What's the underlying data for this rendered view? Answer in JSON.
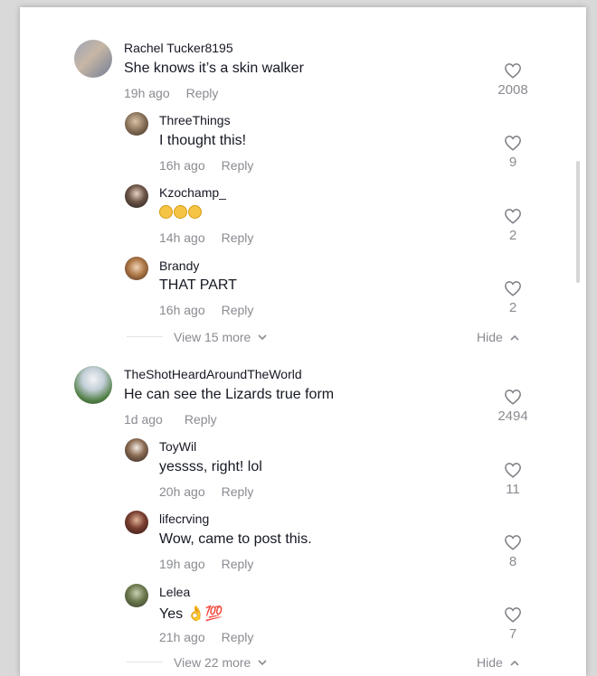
{
  "threads": [
    {
      "comment": {
        "user": "Rachel Tucker8195",
        "text": "She knows it’s a skin walker",
        "time": "19h ago",
        "reply_label": "Reply",
        "likes": "2008"
      },
      "replies": [
        {
          "user": "ThreeThings",
          "text": "I thought this!",
          "time": "16h ago",
          "reply_label": "Reply",
          "likes": "9"
        },
        {
          "user": "Kzochamp_",
          "text": "",
          "emoji": "laughing-tears x3",
          "time": "14h ago",
          "reply_label": "Reply",
          "likes": "2"
        },
        {
          "user": "Brandy",
          "text": "THAT PART",
          "time": "16h ago",
          "reply_label": "Reply",
          "likes": "2"
        }
      ],
      "view_more": "View 15 more",
      "hide": "Hide"
    },
    {
      "comment": {
        "user": "TheShotHeardAroundTheWorld",
        "text": "He can see the Lizards true form",
        "time": "1d ago",
        "reply_label": "Reply",
        "likes": "2494"
      },
      "replies": [
        {
          "user": "ToyWil",
          "text": "yessss, right! lol",
          "time": "20h ago",
          "reply_label": "Reply",
          "likes": "11"
        },
        {
          "user": "lifecrving",
          "text": "Wow, came to post this.",
          "time": "19h ago",
          "reply_label": "Reply",
          "likes": "8"
        },
        {
          "user": "Lelea",
          "text": "Yes 👌💯",
          "time": "21h ago",
          "reply_label": "Reply",
          "likes": "7"
        }
      ],
      "view_more": "View 22 more",
      "hide": "Hide"
    }
  ],
  "colors": {
    "primary_text": "#161823",
    "secondary_text": "#8a8b91",
    "background": "#ffffff"
  },
  "icons": {
    "like": "heart-outline-icon",
    "chevron_down": "chevron-down-icon",
    "chevron_up": "chevron-up-icon"
  }
}
